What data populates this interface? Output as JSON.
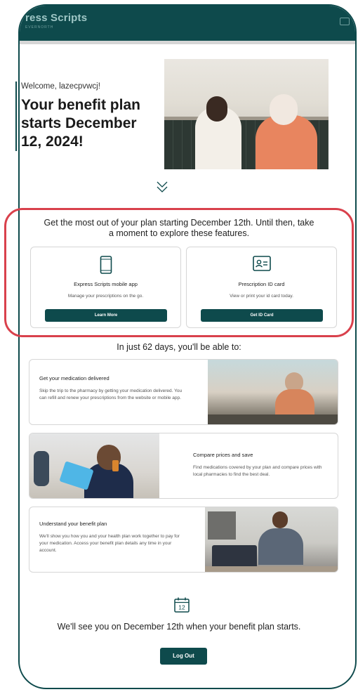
{
  "header": {
    "brand_name": "ress Scripts",
    "brand_sub": "EVERNORTH",
    "brand_color": "#0e4a4c"
  },
  "hero": {
    "welcome": "Welcome, lazecpvwcj!",
    "title": "Your benefit plan starts December 12, 2024!"
  },
  "features": {
    "heading": "Get the most out of your plan starting December 12th. Until then, take a moment to explore these features.",
    "cards": [
      {
        "icon": "smartphone-icon",
        "title": "Express Scripts mobile app",
        "description": "Manage your prescriptions on the go.",
        "button": "Learn More"
      },
      {
        "icon": "id-card-icon",
        "title": "Prescription ID card",
        "description": "View or print your id card today.",
        "button": "Get ID Card"
      }
    ],
    "highlight_color": "#d9414c"
  },
  "days": {
    "heading": "In just 62 days, you'll be able to:"
  },
  "benefits": [
    {
      "title": "Get your medication delivered",
      "description": "Skip the trip to the pharmacy by getting your medication delivered. You can refill and renew your prescriptions from the website or mobile app."
    },
    {
      "title": "Compare prices and save",
      "description": "Find medications covered by your plan and compare prices with local pharmacies to find the best deal."
    },
    {
      "title": "Understand your benefit plan",
      "description": "We'll show you how you and your health plan work together to pay for your medication. Access your benefit plan details any time in your account."
    }
  ],
  "footer": {
    "calendar_day": "12",
    "message": "We'll see you on December 12th when your benefit plan starts.",
    "logout_label": "Log Out"
  }
}
